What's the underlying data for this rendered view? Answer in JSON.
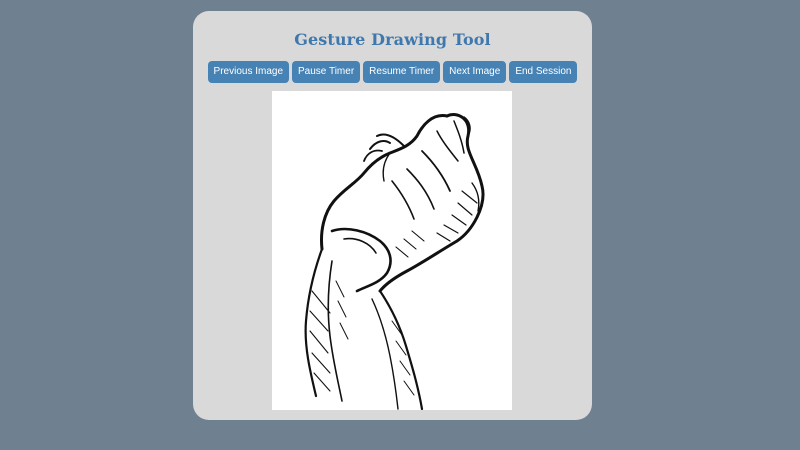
{
  "app": {
    "title": "Gesture Drawing Tool"
  },
  "toolbar": {
    "previous_label": "Previous Image",
    "pause_label": "Pause Timer",
    "resume_label": "Resume Timer",
    "next_label": "Next Image",
    "end_label": "End Session"
  },
  "image": {
    "subject": "ink sketch of a raised hand"
  },
  "colors": {
    "background": "#6f8091",
    "panel": "#d9d9d9",
    "accent": "#4682b4",
    "title": "#3f78ad"
  }
}
